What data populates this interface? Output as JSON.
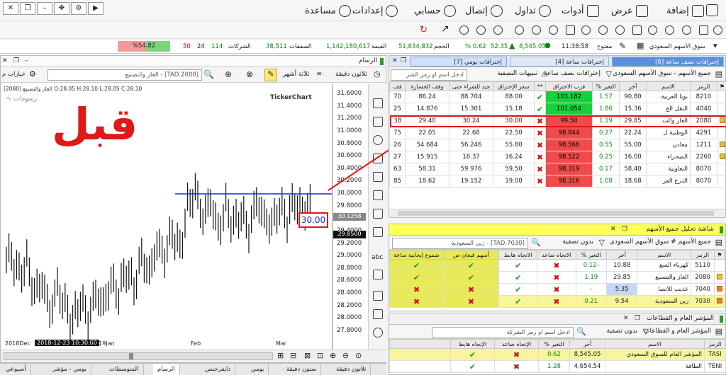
{
  "menu": {
    "add": "إضافة",
    "view": "عرض",
    "tools": "أدوات",
    "trade": "تداول",
    "connect": "إتصال",
    "account": "حسابي",
    "settings": "إعدادات",
    "help": "مساعدة"
  },
  "market": {
    "name": "سوق الأسهم السعودي",
    "status": "مفتوح",
    "time": "11:38:58",
    "index": "8,545.05",
    "change": "52.35",
    "pct": "% 0.62",
    "volume_label": "الحجم",
    "volume": "51,834,832",
    "value_label": "القيمة",
    "value": "1,142,180,617",
    "trades_label": "الصفقات",
    "trades": "38,511",
    "companies_label": "الشركات",
    "up": "114",
    "unchanged": "24",
    "down": "50",
    "breadth": "%54.82"
  },
  "chart": {
    "window_title": "الرسام",
    "interval": "ثلاثون دقيقة",
    "period": "ثلاثة أشهر",
    "symbol_field": "[TAD.2080] - الغاز والتصنيع",
    "options": "خيارات م",
    "ohlc": "الغاز والتصنيع (2080) O:28.05 H:28.10 L:28.05 C:28.10",
    "brand": "TickerChart",
    "drawing_label": "رسومات",
    "before_label": "قبل",
    "target_price": "30.00",
    "price_marker_1": "30.1258",
    "price_marker_2": "29.8500",
    "date_cursor": "2018-12-23 10:30:00",
    "x_labels": [
      "2018Dec",
      "2019Jan",
      "Feb",
      "Mar"
    ],
    "y_ticks": [
      "31.6000",
      "31.4000",
      "31.2000",
      "31.0000",
      "30.8000",
      "30.6000",
      "30.4000",
      "30.2000",
      "30.0000",
      "29.8000",
      "29.6000",
      "29.4000",
      "29.2000",
      "29.0000",
      "28.8000",
      "28.6000",
      "28.4000",
      "28.2000",
      "28.0000",
      "27.8000"
    ]
  },
  "bottom_tabs": [
    "ثلاثون دقيقة",
    "ستون دقيقة",
    "يومي",
    "دايفرجنس",
    "الرسام",
    "المتوسطات",
    "يومي - مؤشر",
    "أسبوعي"
  ],
  "alerts_panel": {
    "tabs": [
      "إختراقات نصف ساعة [6]",
      "إختراقات ساعة [4]",
      "إختراقات يومي [7]"
    ],
    "filter": "جميع الأسهم - سوق الأسهم السعودي",
    "subtitle": "إختراقات نصف ساعة",
    "search_placeholder": "ادخل اسم او رمز الشر",
    "alerts_label": "تنبيهات التصفية",
    "columns": [
      "الرمز",
      "الاسم",
      "أخر",
      "التغير %",
      "قرب الاختراق",
      "**",
      "سعر الإختراق",
      "جيد للشراء حتى",
      "وقف الخسارة",
      "قف"
    ],
    "rows": [
      {
        "sym": "8210",
        "name": "بوبا العربية",
        "last": "90.80",
        "chg": "1.57",
        "near": "103.182",
        "ok": true,
        "brk": "88.00",
        "buy": "88.704",
        "stop": "86.24",
        "q": "70"
      },
      {
        "sym": "4040",
        "name": "النقل الج",
        "last": "15.36",
        "chg": "1.86",
        "near": "101.054",
        "ok": true,
        "brk": "15.18",
        "buy": "15.301",
        "stop": "14.876",
        "q": "25"
      },
      {
        "sym": "2080",
        "name": "الغاز والت",
        "last": "29.85",
        "chg": "1.19",
        "near": "99.50",
        "ok": false,
        "brk": "30.00",
        "buy": "30.24",
        "stop": "29.40",
        "q": "38"
      },
      {
        "sym": "4291",
        "name": "الوطنية ل",
        "last": "22.24",
        "chg": "0.27",
        "near": "98.844",
        "ok": false,
        "brk": "22.50",
        "buy": "22.68",
        "stop": "22.05",
        "q": "75"
      },
      {
        "sym": "1211",
        "name": "معادن",
        "last": "55.00",
        "chg": "0.55",
        "near": "98.566",
        "ok": false,
        "brk": "55.80",
        "buy": "56.246",
        "stop": "54.684",
        "q": "26"
      },
      {
        "sym": "2260",
        "name": "الصحراء",
        "last": "16.00",
        "chg": "0.25",
        "near": "98.522",
        "ok": false,
        "brk": "16.24",
        "buy": "16.37",
        "stop": "15.915",
        "q": "27"
      },
      {
        "sym": "8070",
        "name": "التعاونية",
        "last": "58.40",
        "chg": "0.17",
        "near": "98.319",
        "ok": false,
        "brk": "59.50",
        "buy": "59.976",
        "stop": "58.31",
        "q": "63"
      },
      {
        "sym": "8070",
        "name": "الدرع العر",
        "last": "18.68",
        "chg": "1.08",
        "near": "98.316",
        "ok": false,
        "brk": "19.00",
        "buy": "19.152",
        "stop": "18.62",
        "q": "85"
      }
    ]
  },
  "analysis_panel": {
    "title": "شاشة تحليل جميع الأسهم",
    "filter": "جميع الأسهم # سوق الأسهم السعودي",
    "no_filter": "بدون تصفية",
    "symbol_field": "[TAD.7030] - زين السعودية",
    "columns": [
      "الرمز",
      "الاسم",
      "أخر",
      "التغير %",
      "الاتجاه صاعد",
      "الاتجاه هابط",
      "أسهم قيعان ص",
      "شموع إيجابية ساعة"
    ],
    "rows": [
      {
        "sym": "5110",
        "name": "كهرباء السع",
        "last": "10.88",
        "chg": "-0.12",
        "up": false,
        "down": true,
        "a": true,
        "b": true
      },
      {
        "sym": "2080",
        "name": "الغاز والتصنيع",
        "last": "29.85",
        "chg": "1.19",
        "up": false,
        "down": true,
        "a": true,
        "b": true
      },
      {
        "sym": "7040",
        "name": "عذيب للاتصا",
        "last": "5.35",
        "chg": "-",
        "up": false,
        "down": true,
        "a": false,
        "b": false
      },
      {
        "sym": "7030",
        "name": "زين السعودية",
        "last": "9.54",
        "chg": "0.21",
        "up": false,
        "down": true,
        "a": false,
        "b": false
      }
    ]
  },
  "sectors_panel": {
    "title": "المؤشر العام و القطاعات",
    "filter": "المؤشر العام و القطاعات",
    "no_filter": "بدون تصفية",
    "search_placeholder": "ادخل اسم او رمز الشركة",
    "columns": [
      "الرمز",
      "الاسم",
      "أخر",
      "التغير %",
      "الإتجاه صاعد",
      "الإتجاه هابط"
    ],
    "rows": [
      {
        "sym": "TASI",
        "name": "المؤشر العام للسوق السعودي",
        "last": "8,545.05",
        "chg": "0.62",
        "up": false,
        "down": true
      },
      {
        "sym": "TENI",
        "name": "الطاقة",
        "last": "4,654.54",
        "chg": "1.28",
        "up": false,
        "down": true
      }
    ]
  },
  "chart_data": {
    "type": "line",
    "title": "",
    "xlabel": "",
    "ylabel": "",
    "ylim": [
      27.8,
      31.6
    ],
    "series": [
      {
        "values": [
          29.0,
          28.7,
          28.9,
          28.4,
          28.6,
          28.1,
          28.5,
          28.2,
          27.95,
          28.3,
          28.0,
          28.4,
          28.2,
          28.6,
          28.4,
          28.8,
          28.5,
          29.0,
          28.7,
          29.2,
          29.0,
          29.4,
          29.1,
          29.8,
          30.05,
          29.6,
          29.9,
          29.4,
          29.8,
          29.5,
          29.7,
          29.4,
          29.9,
          29.6,
          29.5,
          29.8,
          29.6,
          29.9,
          29.7,
          29.85
        ]
      }
    ],
    "breakout_line": 30.0
  },
  "colors": {
    "accent": "#1a2fb5",
    "red": "#e01818",
    "green": "#16d13a"
  }
}
